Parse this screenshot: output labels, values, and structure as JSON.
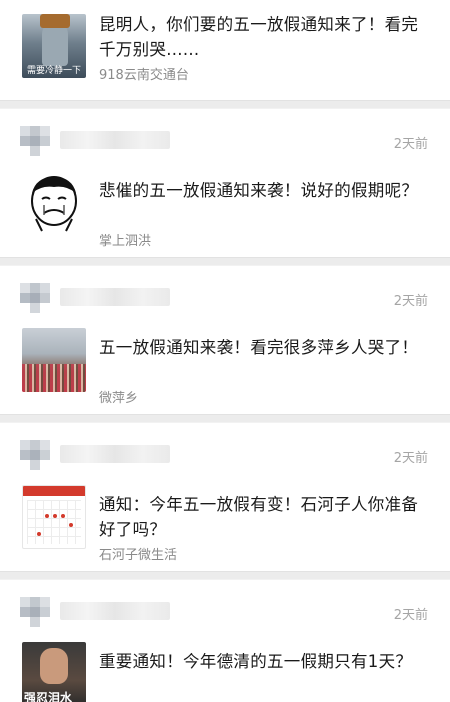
{
  "feed": [
    {
      "has_header": false,
      "title": "昆明人，你们要的五一放假通知来了！看完千万别哭......",
      "source": "918云南交通台",
      "thumb_icon": "bucket-person-thumbnail",
      "thumb_caption": "需要冷静一下"
    },
    {
      "has_header": true,
      "time": "2天前",
      "title": "悲催的五一放假通知来袭！说好的假期呢？",
      "source": "掌上泗洪",
      "thumb_icon": "crying-meme-thumbnail"
    },
    {
      "has_header": true,
      "time": "2天前",
      "title": "五一放假通知来袭！看完很多萍乡人哭了！",
      "source": "微萍乡",
      "thumb_icon": "crowd-mountain-thumbnail"
    },
    {
      "has_header": true,
      "time": "2天前",
      "title": "通知：今年五一放假有变！石河子人你准备好了吗？",
      "source": "石河子微生活",
      "thumb_icon": "calendar-thumbnail"
    },
    {
      "has_header": true,
      "time": "2天前",
      "title": "重要通知！今年德清的五一假期只有1天？",
      "source": "",
      "thumb_icon": "tv-drama-thumbnail",
      "thumb_caption": "强忍泪水"
    }
  ]
}
